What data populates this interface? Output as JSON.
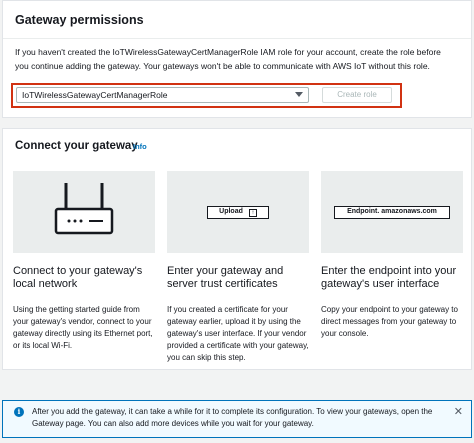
{
  "permissions": {
    "title": "Gateway permissions",
    "description": "If you haven't created the IoTWirelessGatewayCertManagerRole IAM role for your account, create the role before you continue adding the gateway. Your gateways won't be able to communicate with AWS IoT without this role.",
    "role_select": {
      "value": "IoTWirelessGatewayCertManagerRole"
    },
    "create_role_label": "Create role"
  },
  "connect": {
    "title": "Connect your gateway",
    "info_label": "Info",
    "cards": [
      {
        "title": "Connect to your gateway's local network",
        "description": "Using the getting started guide from your gateway's vendor, connect to your gateway directly using its Ethernet port, or its local Wi-Fi."
      },
      {
        "title": "Enter your gateway and server trust certificates",
        "description": "If you created a certificate for your gateway earlier, upload it by using the gateway's user interface. If your vendor provided a certificate with your gateway, you can skip this step.",
        "image_label": "Upload"
      },
      {
        "title": "Enter the endpoint into your gateway's user interface",
        "description": "Copy your endpoint to your gateway to direct messages from your gateway to your console.",
        "image_label": "Endpoint. amazonaws.com"
      }
    ]
  },
  "alert": {
    "text": "After you add the gateway, it can take a while for it to complete its configuration. To view your gateways, open the Gateway page. You can also add more devices while you wait for your gateway."
  }
}
